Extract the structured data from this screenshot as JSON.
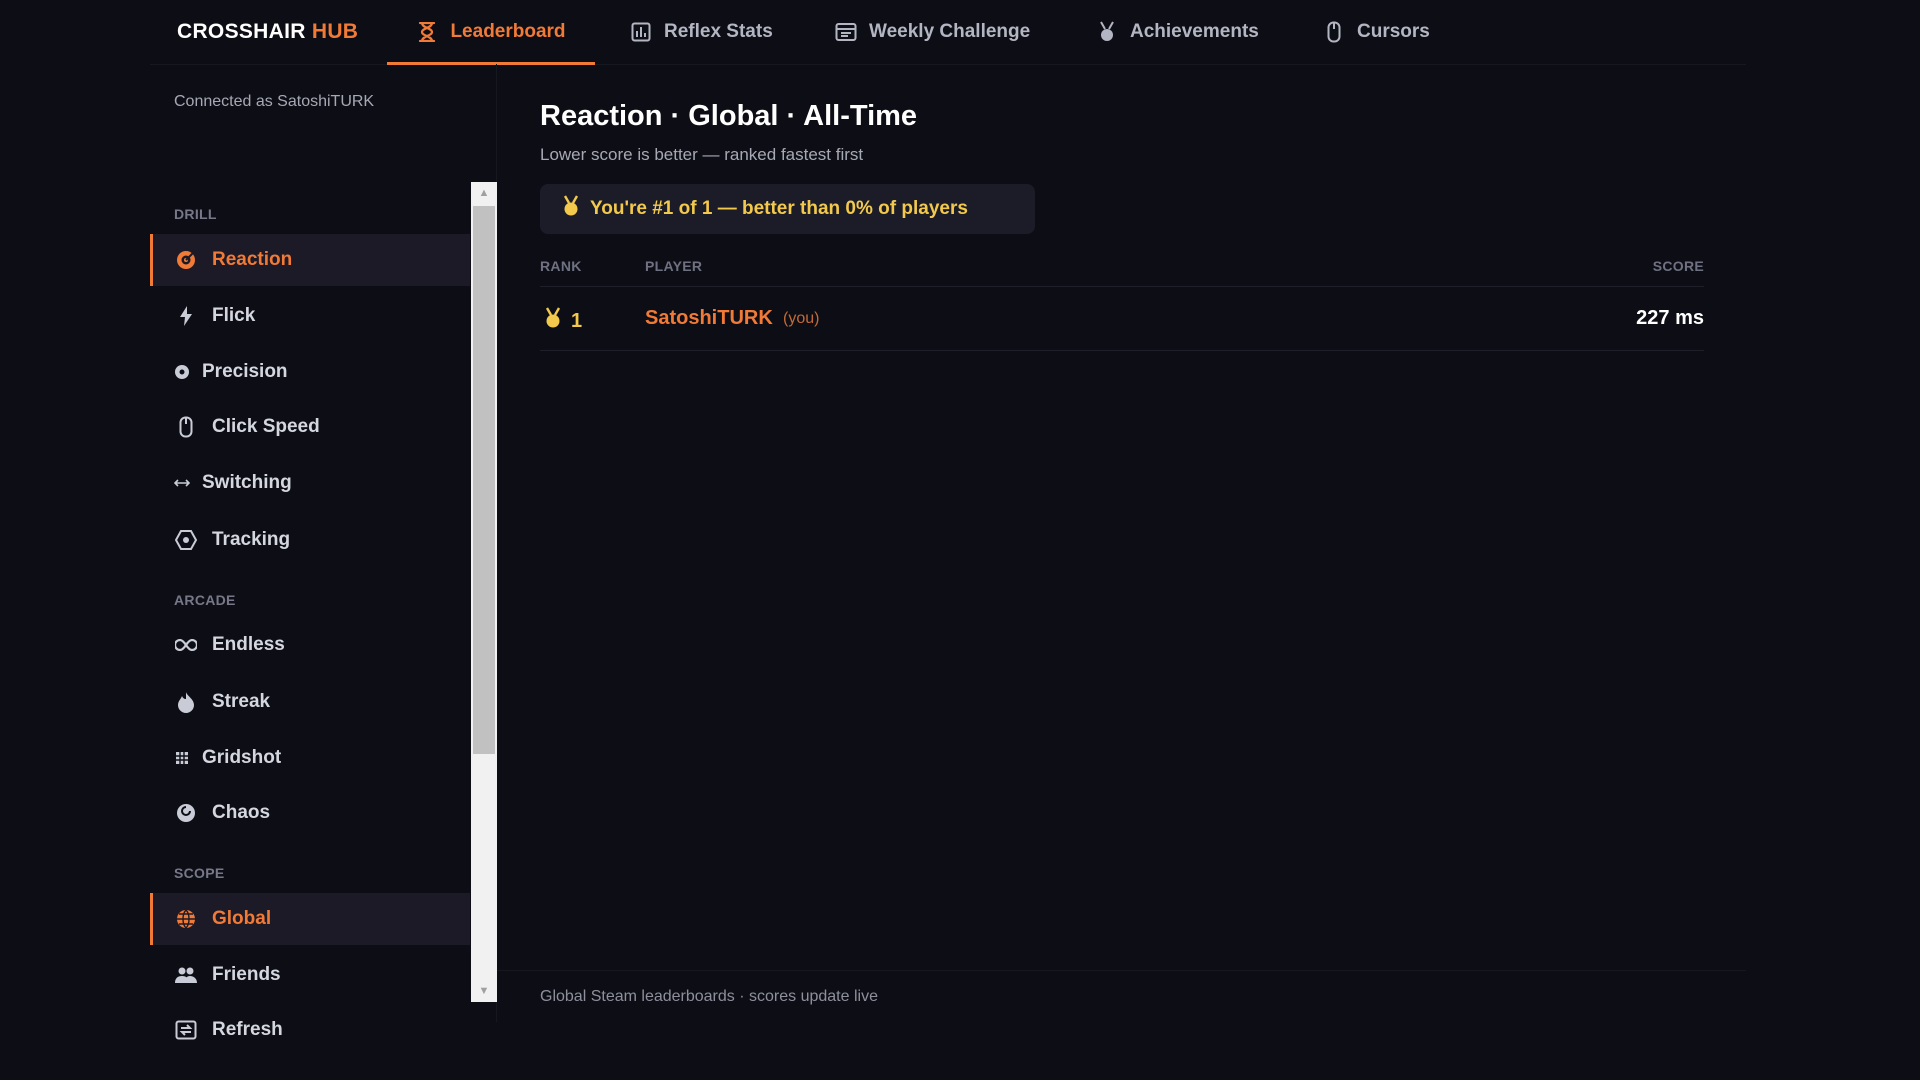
{
  "brand": {
    "part1": "CROSSHAIR",
    "part2": "HUB"
  },
  "nav": {
    "tabs": [
      {
        "label": "Leaderboard",
        "icon": "hourglass-icon",
        "active": true
      },
      {
        "label": "Reflex Stats",
        "icon": "chart-icon",
        "active": false
      },
      {
        "label": "Weekly Challenge",
        "icon": "calendar-icon",
        "active": false
      },
      {
        "label": "Achievements",
        "icon": "medal-icon",
        "active": false
      },
      {
        "label": "Cursors",
        "icon": "mouse-icon",
        "active": false
      }
    ]
  },
  "sidebar": {
    "connected": "Connected as SatoshiTURK",
    "sections": {
      "drill": "DRILL",
      "arcade": "ARCADE",
      "scope": "SCOPE"
    },
    "drill": [
      {
        "label": "Reaction",
        "icon": "target-icon",
        "active": true
      },
      {
        "label": "Flick",
        "icon": "lightning-icon",
        "active": false
      },
      {
        "label": "Precision",
        "icon": "crosshair-icon",
        "active": false
      },
      {
        "label": "Click Speed",
        "icon": "mouse-icon",
        "active": false
      },
      {
        "label": "Switching",
        "icon": "arrows-horizontal-icon",
        "active": false
      },
      {
        "label": "Tracking",
        "icon": "tracking-icon",
        "active": false
      }
    ],
    "arcade": [
      {
        "label": "Endless",
        "icon": "infinity-icon",
        "active": false
      },
      {
        "label": "Streak",
        "icon": "flame-icon",
        "active": false
      },
      {
        "label": "Gridshot",
        "icon": "grid-icon",
        "active": false
      },
      {
        "label": "Chaos",
        "icon": "swirl-icon",
        "active": false
      }
    ],
    "scope": [
      {
        "label": "Global",
        "icon": "globe-icon",
        "active": true
      },
      {
        "label": "Friends",
        "icon": "friends-icon",
        "active": false
      }
    ],
    "refresh": {
      "label": "Refresh",
      "icon": "refresh-icon"
    }
  },
  "main": {
    "title": "Reaction · Global · All-Time",
    "subtitle": "Lower score is better — ranked fastest first",
    "banner": "You're #1 of 1 — better than 0% of players",
    "columns": {
      "rank": "RANK",
      "player": "PLAYER",
      "score": "SCORE"
    },
    "rows": [
      {
        "rank": "1",
        "player": "SatoshiTURK",
        "tag": "(you)",
        "score": "227 ms"
      }
    ],
    "footer": "Global Steam leaderboards · scores update live"
  },
  "colors": {
    "accent": "#f07a36",
    "gold": "#f2c94c",
    "background": "#0d0e15"
  }
}
